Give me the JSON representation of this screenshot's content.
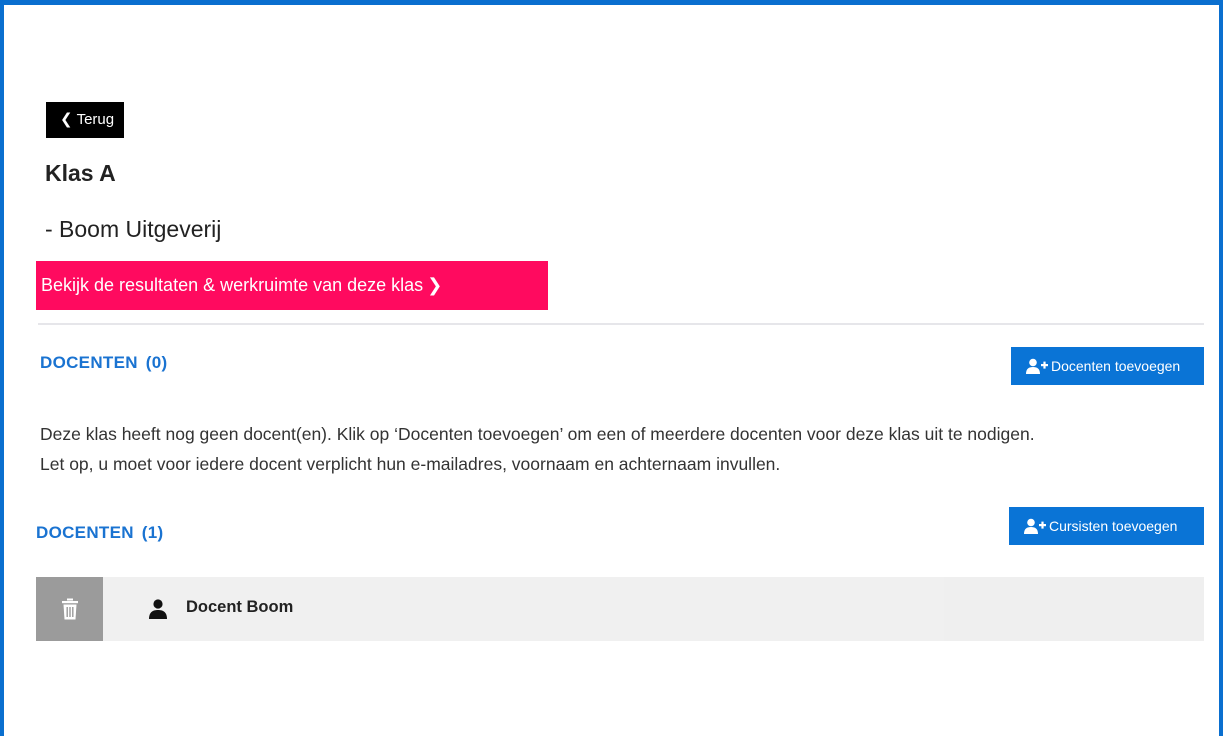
{
  "back_button": {
    "label": "Terug"
  },
  "class": {
    "title": "Klas A",
    "publisher": "- Boom Uitgeverij"
  },
  "results_button": {
    "label": "Bekijk de resultaten & werkruimte van deze klas"
  },
  "docenten_section": {
    "heading": "DOCENTEN",
    "count": "(0)",
    "add_button": "Docenten toevoegen",
    "info_line_1": "Deze klas heeft nog geen docent(en). Klik op ‘Docenten toevoegen’ om een of meerdere docenten voor deze klas uit te nodigen.",
    "info_line_2": "Let op, u moet voor iedere docent verplicht hun e-mailadres, voornaam en achternaam invullen."
  },
  "cursisten_section": {
    "heading": "DOCENTEN",
    "count": "(1)",
    "add_button": "Cursisten toevoegen",
    "members": [
      {
        "name": "Docent Boom"
      }
    ]
  },
  "icons": {
    "back": "chevron-left-icon",
    "forward": "chevron-right-icon",
    "add_user": "add-user-icon",
    "delete": "trash-icon",
    "person": "person-icon"
  },
  "colors": {
    "frame": "#0a6fcf",
    "accent_pink": "#ff0a5f",
    "primary_blue": "#0a74d6",
    "heading_blue": "#1a73d1"
  }
}
